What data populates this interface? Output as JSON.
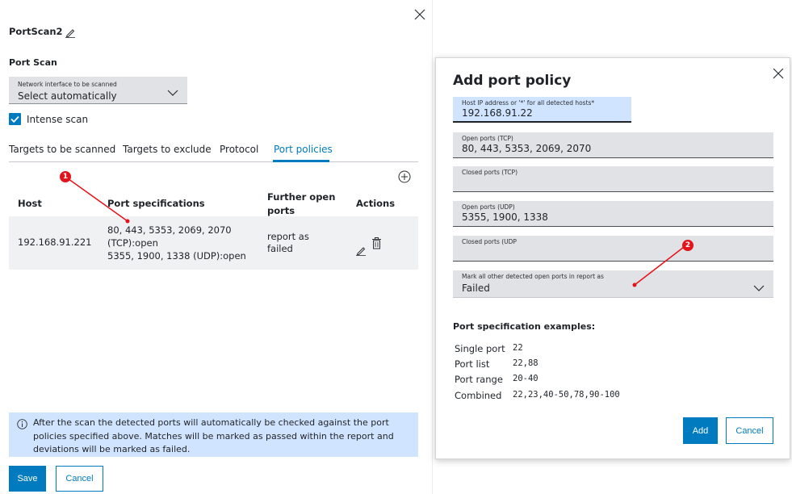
{
  "left_panel": {
    "title": "PortScan2",
    "section_title": "Port Scan",
    "network_interface": {
      "label": "Network interface to be scanned",
      "value": "Select automatically"
    },
    "intense_scan": {
      "label": "Intense scan",
      "checked": true
    },
    "tabs": [
      {
        "label": "Targets to be scanned",
        "active": false
      },
      {
        "label": "Targets to exclude",
        "active": false
      },
      {
        "label": "Protocol",
        "active": false
      },
      {
        "label": "Port policies",
        "active": true
      }
    ],
    "table": {
      "headers": {
        "host": "Host",
        "port_specs": "Port specifications",
        "further_open": "Further open ports",
        "actions": "Actions"
      },
      "rows": [
        {
          "host": "192.168.91.221",
          "port_specs_line1": "80, 443, 5353, 2069, 2070",
          "port_specs_line2": "(TCP):open",
          "port_specs_line3": "5355, 1900, 1338 (UDP):open",
          "further_open": "report as failed"
        }
      ]
    },
    "info_text": "After the scan the detected ports will automatically be checked against the port policies specified above. Matches will be marked as passed within the report and deviations will be marked as failed.",
    "save_label": "Save",
    "cancel_label": "Cancel"
  },
  "dialog": {
    "title": "Add port policy",
    "host_field": {
      "label": "Host IP address or '*' for all detected hosts*",
      "value": "192.168.91.22"
    },
    "open_tcp": {
      "label": "Open ports (TCP)",
      "value": "80, 443, 5353, 2069, 2070"
    },
    "closed_tcp": {
      "label": "Closed ports (TCP)",
      "value": ""
    },
    "open_udp": {
      "label": "Open ports (UDP)",
      "value": "5355, 1900, 1338"
    },
    "closed_udp": {
      "label": "Closed ports (UDP",
      "value": ""
    },
    "mark_other": {
      "label": "Mark all other detected open ports in report as",
      "value": "Failed"
    },
    "examples_title": "Port specification examples:",
    "examples": [
      {
        "name": "Single port",
        "value": "22"
      },
      {
        "name": "Port list",
        "value": "22,88"
      },
      {
        "name": "Port range",
        "value": "20-40"
      },
      {
        "name": "Combined",
        "value": "22,23,40-50,78,90-100"
      }
    ],
    "add_label": "Add",
    "cancel_label": "Cancel"
  },
  "annotations": [
    {
      "number": "1"
    },
    {
      "number": "2"
    }
  ],
  "colors": {
    "accent": "#007bc0",
    "field_bg": "#e0e2e5",
    "info_bg": "#d1e4ff",
    "badge": "#e4131a",
    "host_field_bg": "#d1e4ff"
  },
  "icons": [
    "edit-pencil-icon",
    "close-icon",
    "chevron-down-icon",
    "checkmark-icon",
    "add-circle-icon",
    "delete-trash-icon",
    "info-icon"
  ]
}
